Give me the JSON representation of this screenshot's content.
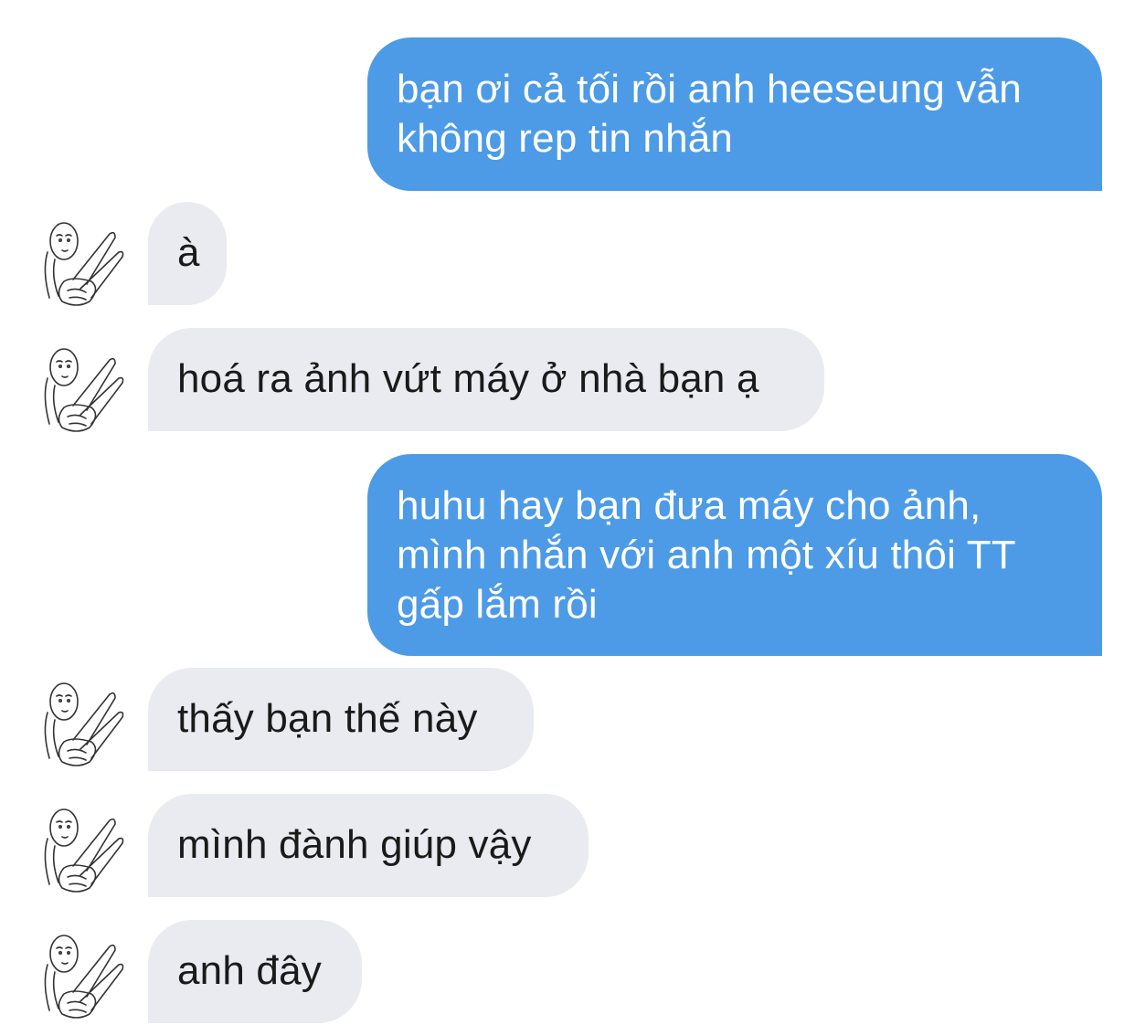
{
  "messages": [
    {
      "direction": "sent",
      "text": "bạn ơi cả tối rồi anh heeseung vẫn không rep tin nhắn"
    },
    {
      "direction": "received",
      "text": "à",
      "avatar_icon": "peace-sign-doodle-icon"
    },
    {
      "direction": "received",
      "text": "hoá ra ảnh vứt máy ở nhà bạn ạ",
      "avatar_icon": "peace-sign-doodle-icon"
    },
    {
      "direction": "sent",
      "text": "huhu hay bạn đưa máy cho ảnh, mình nhắn với anh một xíu thôi TT gấp lắm rồi"
    },
    {
      "direction": "received",
      "text": "thấy bạn thế này",
      "avatar_icon": "peace-sign-doodle-icon"
    },
    {
      "direction": "received",
      "text": "mình đành giúp vậy",
      "avatar_icon": "peace-sign-doodle-icon"
    },
    {
      "direction": "received",
      "text": "anh đây",
      "avatar_icon": "peace-sign-doodle-icon"
    }
  ],
  "colors": {
    "sent_bubble": "#4d9be6",
    "received_bubble": "#e9ebf0",
    "sent_text": "#ffffff",
    "received_text": "#1a1a1a"
  }
}
